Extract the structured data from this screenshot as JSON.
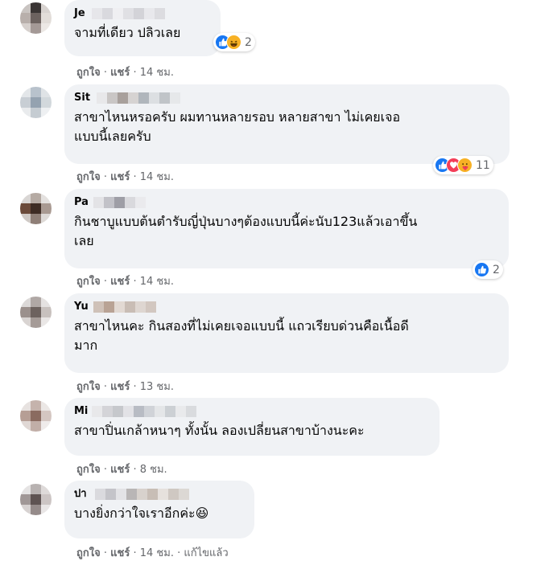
{
  "comments": [
    {
      "name": "Je",
      "text_lines": [
        "จามที่เดียว ปลิวเลย"
      ],
      "reaction_count": "2",
      "like_label": "ถูกใจ",
      "share_label": "แชร์",
      "time": "14 ชม.",
      "edited": ""
    },
    {
      "name": "Sit",
      "text_lines": [
        "สาขาไหนหรอครับ ผมทานหลายรอบ หลายสาขา ไม่เคยเจอ",
        "แบบนี้เลยครับ"
      ],
      "reaction_count": "11",
      "like_label": "ถูกใจ",
      "share_label": "แชร์",
      "time": "14 ชม.",
      "edited": ""
    },
    {
      "name": "Pa",
      "text_lines": [
        "กินชาบูแบบต้นตำรับญี่ปุ่นบางๆต้องแบบนี้ค่ะนับ123แล้วเอาขึ้น",
        "เลย"
      ],
      "reaction_count": "2",
      "like_label": "ถูกใจ",
      "share_label": "แชร์",
      "time": "14 ชม.",
      "edited": ""
    },
    {
      "name": "Yu",
      "text_lines": [
        "สาขาไหนคะ กินสองที่ไม่เคยเจอแบบนี้ แถวเรียบด่วนคือเนื้อดี",
        "มาก"
      ],
      "reaction_count": "",
      "like_label": "ถูกใจ",
      "share_label": "แชร์",
      "time": "13 ชม.",
      "edited": ""
    },
    {
      "name": "Mi",
      "text_lines": [
        "สาขาปิ่นเกล้าหนาๆ ทั้งนั้น ลองเปลี่ยนสาขาบ้างนะคะ"
      ],
      "reaction_count": "",
      "like_label": "ถูกใจ",
      "share_label": "แชร์",
      "time": "8 ชม.",
      "edited": ""
    },
    {
      "name": "ปา",
      "text_lines": [
        "บางยิ่งกว่าใจเราอีกค่ะ😆"
      ],
      "reaction_count": "",
      "like_label": "ถูกใจ",
      "share_label": "แชร์",
      "time": "14 ชม.",
      "edited": "แก้ไขแล้ว"
    }
  ],
  "separator": "·",
  "colors": {
    "bubble_bg": "#f0f2f5",
    "text": "#050505",
    "secondary": "#65676b",
    "like_blue": "#1877f2",
    "love_red": "#f33e58",
    "haha_yellow": "#f7b125"
  }
}
